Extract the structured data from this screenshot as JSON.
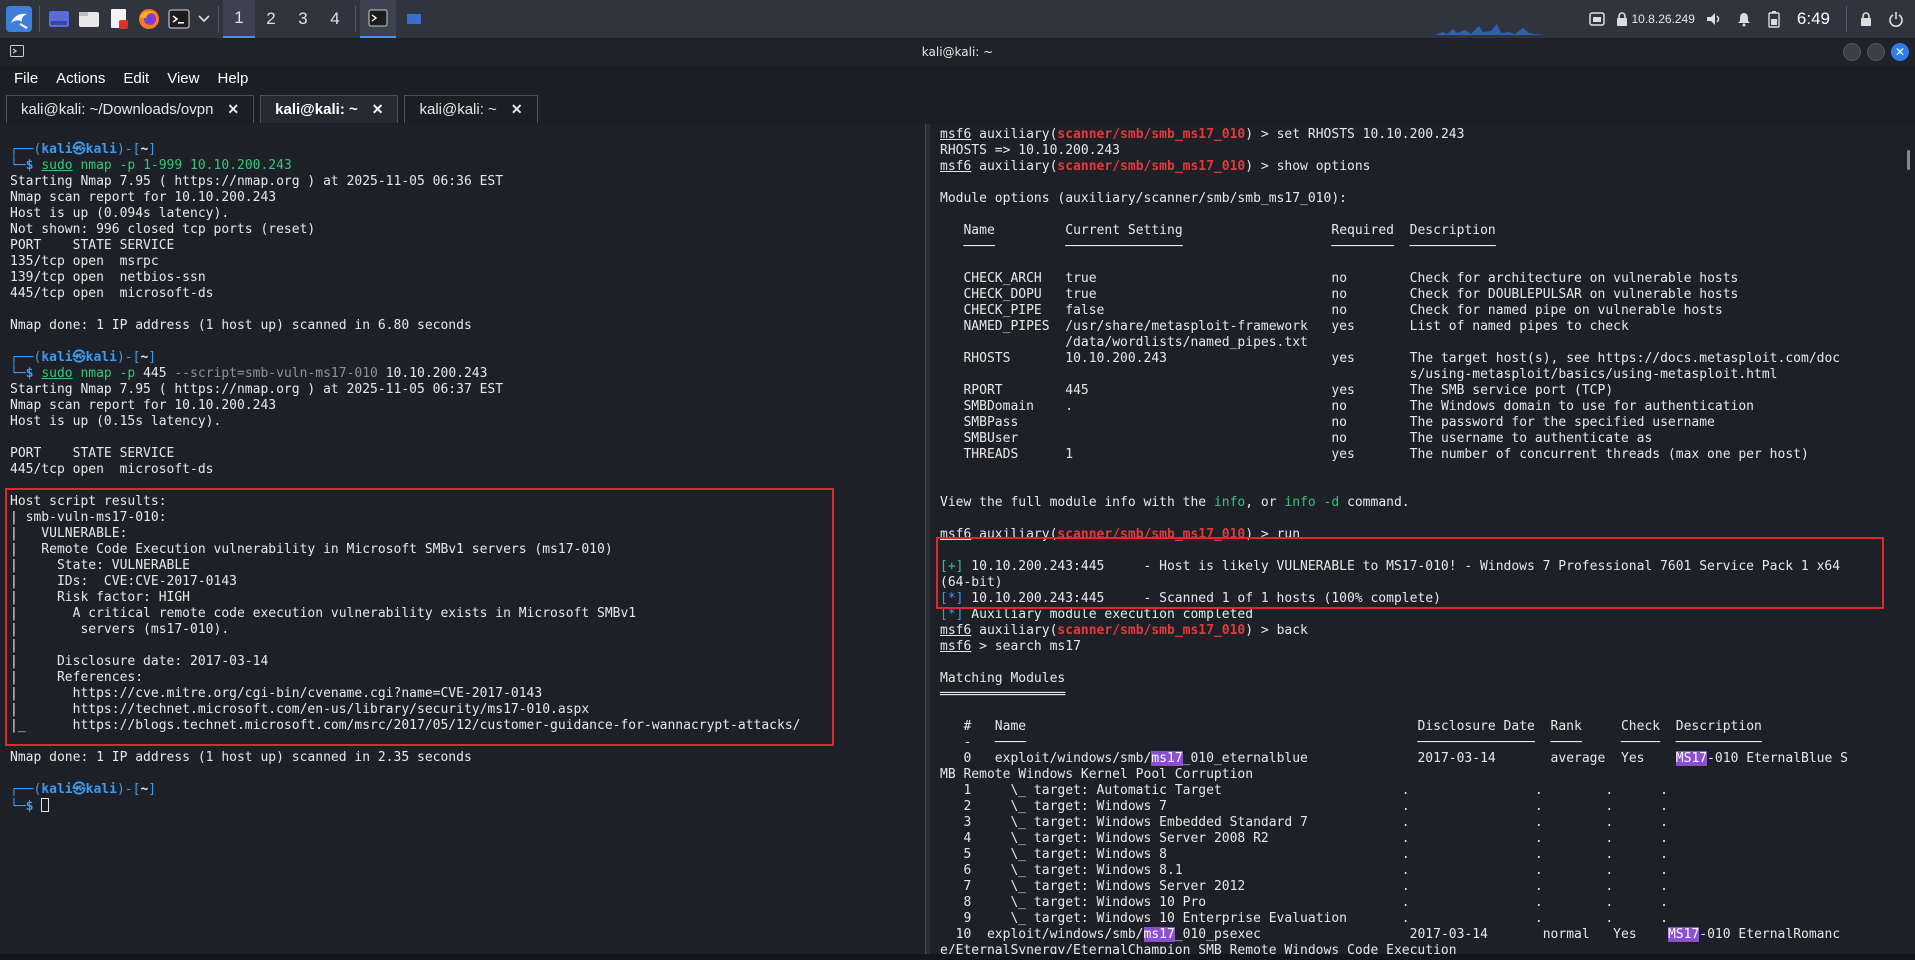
{
  "panel": {
    "workspaces": [
      "1",
      "2",
      "3",
      "4"
    ],
    "active_workspace": "1",
    "ip": "10.8.26.249",
    "clock": "6:49"
  },
  "window": {
    "title": "kali@kali: ~",
    "menu": [
      "File",
      "Actions",
      "Edit",
      "View",
      "Help"
    ],
    "tabs": [
      {
        "label": "kali@kali: ~/Downloads/ovpn",
        "active": false
      },
      {
        "label": "kali@kali: ~",
        "active": true
      },
      {
        "label": "kali@kali: ~",
        "active": false
      }
    ]
  },
  "left_terminal": {
    "prompt_user": "kali",
    "prompt_host": "kali",
    "prompt_dir": "~",
    "cmd1_sudo": "sudo",
    "cmd1": "nmap -p 1-999 10.10.200.243",
    "out1": [
      "Starting Nmap 7.95 ( https://nmap.org ) at 2025-11-05 06:36 EST",
      "Nmap scan report for 10.10.200.243",
      "Host is up (0.094s latency).",
      "Not shown: 996 closed tcp ports (reset)",
      "PORT    STATE SERVICE",
      "135/tcp open  msrpc",
      "139/tcp open  netbios-ssn",
      "445/tcp open  microsoft-ds",
      "",
      "Nmap done: 1 IP address (1 host up) scanned in 6.80 seconds"
    ],
    "cmd2_sudo": "sudo",
    "cmd2_a": "nmap -p ",
    "cmd2_b": "445",
    "cmd2_c": " --script=smb-vuln-ms17-010 ",
    "cmd2_d": "10.10.200.243",
    "out2": [
      "Starting Nmap 7.95 ( https://nmap.org ) at 2025-11-05 06:37 EST",
      "Nmap scan report for 10.10.200.243",
      "Host is up (0.15s latency).",
      "",
      "PORT    STATE SERVICE",
      "445/tcp open  microsoft-ds",
      "",
      "Host script results:",
      "| smb-vuln-ms17-010:",
      "|   VULNERABLE:",
      "|   Remote Code Execution vulnerability in Microsoft SMBv1 servers (ms17-010)",
      "|     State: VULNERABLE",
      "|     IDs:  CVE:CVE-2017-0143",
      "|     Risk factor: HIGH",
      "|       A critical remote code execution vulnerability exists in Microsoft SMBv1",
      "|        servers (ms17-010).",
      "|",
      "|     Disclosure date: 2017-03-14",
      "|     References:",
      "|       https://cve.mitre.org/cgi-bin/cvename.cgi?name=CVE-2017-0143",
      "|       https://technet.microsoft.com/en-us/library/security/ms17-010.aspx",
      "|_      https://blogs.technet.microsoft.com/msrc/2017/05/12/customer-guidance-for-wannacrypt-attacks/",
      "",
      "Nmap done: 1 IP address (1 host up) scanned in 2.35 seconds"
    ]
  },
  "right_terminal": {
    "msf": "msf6",
    "aux": "auxiliary(",
    "module": "scanner/smb/smb_ms17_010",
    "aux_close": ") > ",
    "cmd_set": "set RHOSTS 10.10.200.243",
    "rhosts_echo": "RHOSTS => 10.10.200.243",
    "cmd_show": "show options",
    "module_options_heading": "Module options (auxiliary/scanner/smb/smb_ms17_010):",
    "options_headers": [
      "Name",
      "Current Setting",
      "Required",
      "Description"
    ],
    "options_rows": [
      [
        "CHECK_ARCH",
        "true",
        "no",
        "Check for architecture on vulnerable hosts"
      ],
      [
        "CHECK_DOPU",
        "true",
        "no",
        "Check for DOUBLEPULSAR on vulnerable hosts"
      ],
      [
        "CHECK_PIPE",
        "false",
        "no",
        "Check for named pipe on vulnerable hosts"
      ],
      [
        "NAMED_PIPES",
        "/usr/share/metasploit-framework",
        "yes",
        "List of named pipes to check"
      ],
      [
        "",
        "/data/wordlists/named_pipes.txt",
        "",
        ""
      ],
      [
        "RHOSTS",
        "10.10.200.243",
        "yes",
        "The target host(s), see https://docs.metasploit.com/doc"
      ],
      [
        "",
        "",
        "",
        "s/using-metasploit/basics/using-metasploit.html"
      ],
      [
        "RPORT",
        "445",
        "yes",
        "The SMB service port (TCP)"
      ],
      [
        "SMBDomain",
        ".",
        "no",
        "The Windows domain to use for authentication"
      ],
      [
        "SMBPass",
        "",
        "no",
        "The password for the specified username"
      ],
      [
        "SMBUser",
        "",
        "no",
        "The username to authenticate as"
      ],
      [
        "THREADS",
        "1",
        "yes",
        "The number of concurrent threads (max one per host)"
      ]
    ],
    "view_info_a": "View the full module info with the ",
    "view_info_b": "info",
    "view_info_c": ", or ",
    "view_info_d": "info -d",
    "view_info_e": " command.",
    "cmd_run": "run",
    "run_plus": "[+]",
    "run_star": "[*]",
    "run_line1": " 10.10.200.243:445     - Host is likely VULNERABLE to MS17-010! - Windows 7 Professional 7601 Service Pack 1 x64",
    "run_line1b": "(64-bit)",
    "run_line2": " 10.10.200.243:445     - Scanned 1 of 1 hosts (100% complete)",
    "run_line3": " Auxiliary module execution completed",
    "cmd_back": "back",
    "cmd_search": "search ms17",
    "matching_heading": "Matching Modules",
    "modules_headers": [
      "#",
      "Name",
      "Disclosure Date",
      "Rank",
      "Check",
      "Description"
    ],
    "modules": [
      {
        "num": "0",
        "pre": "exploit/windows/smb/",
        "hl": "ms17",
        "post": "_010_eternalblue",
        "date": "2017-03-14",
        "rank": "average",
        "check": "Yes",
        "desc_hl": "MS17",
        "desc": "-010 EternalBlue S",
        "wrap": "MB Remote Windows Kernel Pool Corruption"
      },
      {
        "num": "1",
        "target": "\\_ target: Automatic Target"
      },
      {
        "num": "2",
        "target": "\\_ target: Windows 7"
      },
      {
        "num": "3",
        "target": "\\_ target: Windows Embedded Standard 7"
      },
      {
        "num": "4",
        "target": "\\_ target: Windows Server 2008 R2"
      },
      {
        "num": "5",
        "target": "\\_ target: Windows 8"
      },
      {
        "num": "6",
        "target": "\\_ target: Windows 8.1"
      },
      {
        "num": "7",
        "target": "\\_ target: Windows Server 2012"
      },
      {
        "num": "8",
        "target": "\\_ target: Windows 10 Pro"
      },
      {
        "num": "9",
        "target": "\\_ target: Windows 10 Enterprise Evaluation"
      },
      {
        "num": "10",
        "pre": "exploit/windows/smb/",
        "hl": "ms17",
        "post": "_010_psexec",
        "date": "2017-03-14",
        "rank": "normal",
        "check": "Yes",
        "desc_hl": "MS17",
        "desc": "-010 EternalRomanc",
        "wrap": "e/EternalSynergy/EternalChampion SMB Remote Windows Code Execution"
      }
    ],
    "dot": "."
  }
}
